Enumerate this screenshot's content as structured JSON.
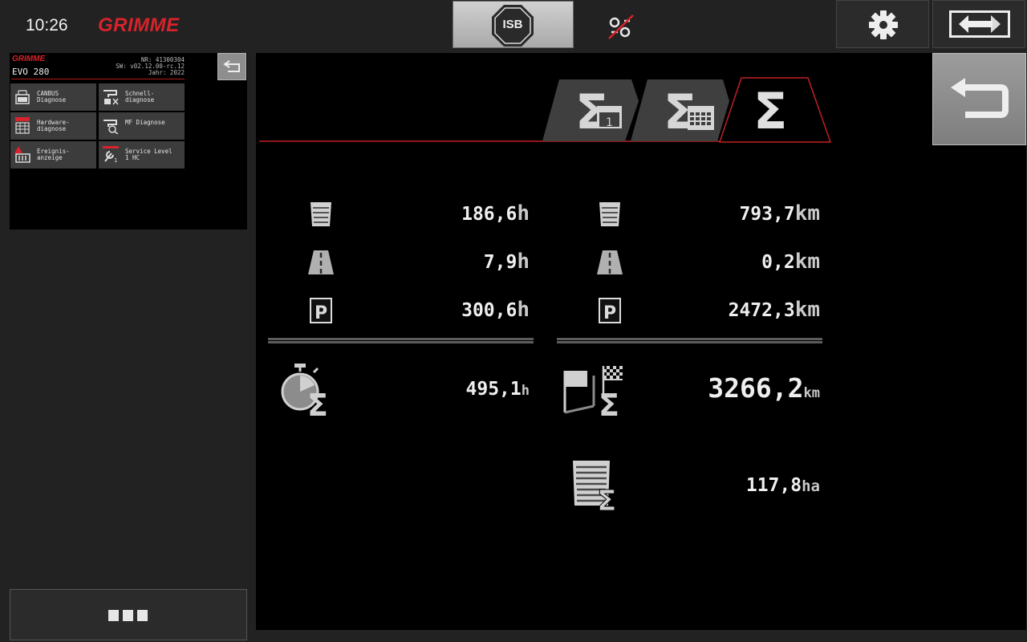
{
  "header": {
    "clock": "10:26",
    "brand": "GRIMME",
    "isb_label": "ISB"
  },
  "mini_panel": {
    "brand": "GRIMME",
    "model": "EVO 280",
    "info_lines": [
      "NR:  41300304",
      "SW: v02.12.00-rc.12",
      "Jahr:  2022"
    ],
    "tiles": [
      {
        "label": "CANBUS\nDiagnose",
        "icon": "canbus-icon"
      },
      {
        "label": "Schnell-\ndiagnose",
        "icon": "quick-diagnose-icon"
      },
      {
        "label": "Hardware-\ndiagnose",
        "icon": "hardware-diagnose-icon"
      },
      {
        "label": "MF Diagnose",
        "icon": "mf-diagnose-icon"
      },
      {
        "label": "Ereignis-\nanzeige",
        "icon": "event-display-icon"
      },
      {
        "label": "Service Level\n1 HC",
        "icon": "service-wrench-icon"
      }
    ]
  },
  "tabs": [
    {
      "icon": "sum-day-icon",
      "sub": "1",
      "active": false
    },
    {
      "icon": "sum-calendar-icon",
      "active": false
    },
    {
      "icon": "sum-total-icon",
      "active": true
    }
  ],
  "stats": {
    "hours": {
      "field": {
        "value": "186,6",
        "unit": "h",
        "icon": "field-icon"
      },
      "road": {
        "value": "7,9",
        "unit": "h",
        "icon": "road-icon"
      },
      "parking": {
        "value": "300,6",
        "unit": "h",
        "icon": "parking-icon"
      },
      "total": {
        "value": "495,1",
        "unit": "h",
        "icon": "stopwatch-sum-icon"
      }
    },
    "distance": {
      "field": {
        "value": "793,7",
        "unit": "km",
        "icon": "field-icon"
      },
      "road": {
        "value": "0,2",
        "unit": "km",
        "icon": "road-icon"
      },
      "parking": {
        "value": "2472,3",
        "unit": "km",
        "icon": "parking-icon"
      },
      "total": {
        "value": "3266,2",
        "unit": "km",
        "icon": "flags-sum-icon"
      }
    },
    "area": {
      "value": "117,8",
      "unit": "ha",
      "icon": "area-sum-icon"
    }
  },
  "colors": {
    "accent": "#d8232a",
    "background": "#000000",
    "chrome": "#222222"
  }
}
